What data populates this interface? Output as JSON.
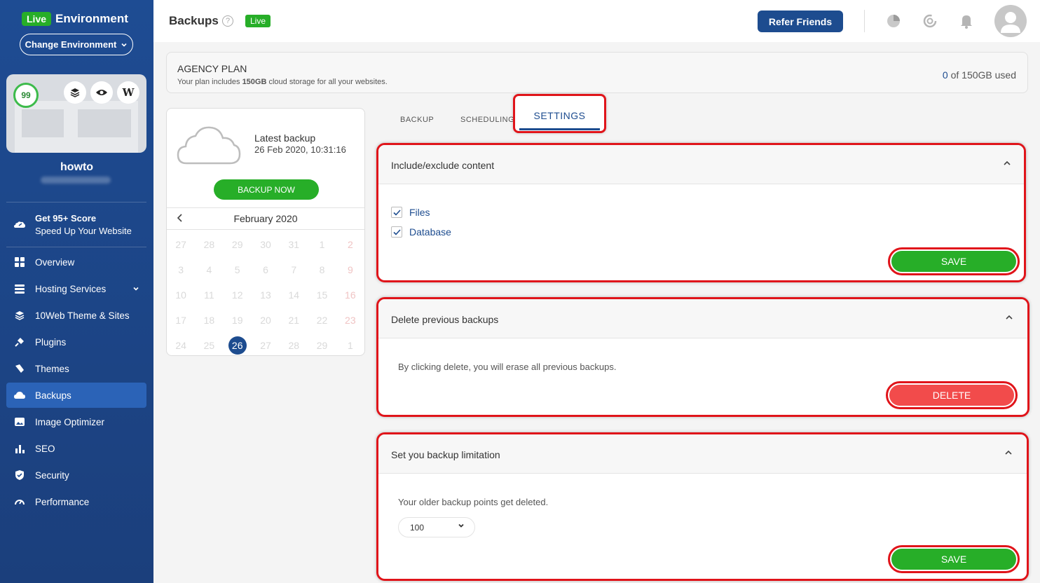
{
  "sidebar": {
    "live_badge": "Live",
    "env_title": "Environment",
    "change_env": "Change Environment",
    "score": "99",
    "site_name": "howto",
    "promo_title": "Get 95+ Score",
    "promo_sub": "Speed Up Your Website",
    "items": [
      {
        "label": "Overview",
        "icon": "grid-icon"
      },
      {
        "label": "Hosting Services",
        "icon": "server-icon"
      },
      {
        "label": "10Web Theme & Sites",
        "icon": "layers-icon"
      },
      {
        "label": "Plugins",
        "icon": "plug-icon"
      },
      {
        "label": "Themes",
        "icon": "brush-icon"
      },
      {
        "label": "Backups",
        "icon": "cloud-backup-icon"
      },
      {
        "label": "Image Optimizer",
        "icon": "image-icon"
      },
      {
        "label": "SEO",
        "icon": "bar-chart-icon"
      },
      {
        "label": "Security",
        "icon": "shield-icon"
      },
      {
        "label": "Performance",
        "icon": "gauge-icon"
      }
    ]
  },
  "header": {
    "title": "Backups",
    "live_badge": "Live",
    "refer_label": "Refer Friends"
  },
  "plan": {
    "title": "AGENCY PLAN",
    "desc_pre": "Your plan includes ",
    "desc_bold": "150GB",
    "desc_post": " cloud storage for all your websites.",
    "used_num": "0",
    "used_rest": " of 150GB used"
  },
  "latest": {
    "label": "Latest backup",
    "date": "26 Feb 2020, 10:31:16",
    "backup_now": "BACKUP NOW"
  },
  "calendar": {
    "month": "February 2020",
    "prev": "<",
    "days": [
      "27",
      "28",
      "29",
      "30",
      "31",
      "1",
      "2",
      "3",
      "4",
      "5",
      "6",
      "7",
      "8",
      "9",
      "10",
      "11",
      "12",
      "13",
      "14",
      "15",
      "16",
      "17",
      "18",
      "19",
      "20",
      "21",
      "22",
      "23",
      "24",
      "25",
      "26",
      "27",
      "28",
      "29",
      "1"
    ]
  },
  "tabs": {
    "backup": "BACKUP",
    "scheduling": "SCHEDULING",
    "settings": "SETTINGS"
  },
  "include": {
    "title": "Include/exclude content",
    "files": "Files",
    "database": "Database",
    "save": "SAVE"
  },
  "delete": {
    "title": "Delete previous backups",
    "text": "By clicking delete, you will erase all previous backups.",
    "button": "DELETE"
  },
  "limit": {
    "title": "Set you backup limitation",
    "text": "Your older backup points get deleted.",
    "value": "100",
    "save": "SAVE"
  }
}
